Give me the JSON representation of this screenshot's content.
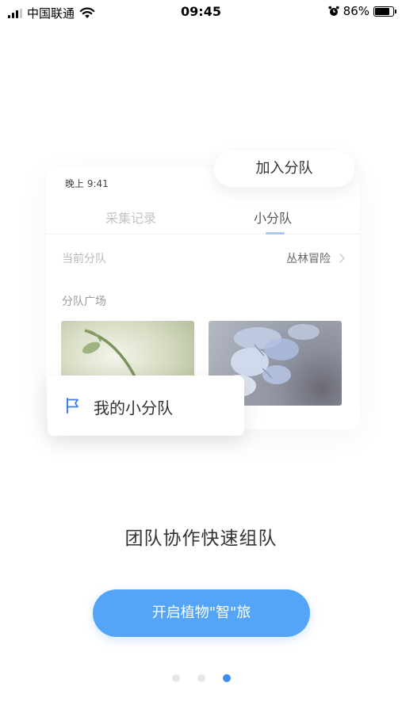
{
  "status_bar": {
    "carrier": "中国联通",
    "time": "09:45",
    "battery_percent": "86%",
    "battery_level": 0.86,
    "icons": [
      "signal-icon",
      "wifi-icon",
      "alarm-icon",
      "battery-icon"
    ]
  },
  "illustration": {
    "phone_time": "晚上 9:41",
    "join_team_label": "加入分队",
    "tabs": [
      {
        "label": "采集记录"
      },
      {
        "label": "小分队"
      }
    ],
    "current_team_label": "当前分队",
    "current_team_value": "丛林冒险",
    "team_square_title": "分队广场",
    "my_team_label": "我的小分队"
  },
  "slogan": "团队协作快速组队",
  "cta_label": "开启植物\"智\"旅",
  "pagination": {
    "total": 3,
    "active_index": 2
  },
  "colors": {
    "primary": "#54a4f8",
    "dot_active": "#3d8ef2",
    "tab_underline": "#a9c8f2",
    "flag": "#3d7fe0"
  }
}
